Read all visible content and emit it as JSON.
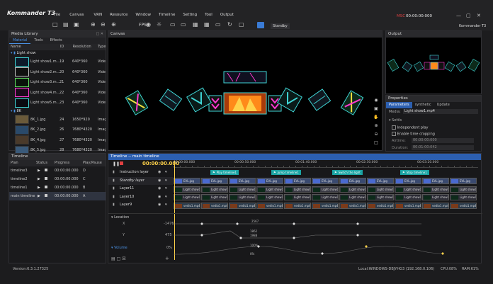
{
  "app": {
    "logo": "Kommander T3",
    "title_right": "Kommander T3",
    "timecode": "00:00:00:000",
    "timecode_prefix": "MSC"
  },
  "menu": [
    "File",
    "Canvas",
    "VRN",
    "Resource",
    "Window",
    "Timeline",
    "Setting",
    "Tool",
    "Output"
  ],
  "toolbar": {
    "fps_label": "FPS",
    "standby_label": "Standby"
  },
  "media_library": {
    "title": "Media Library",
    "tabs": [
      "Material",
      "Tools",
      "Effects"
    ],
    "columns": [
      "Name",
      "ID",
      "Resolution",
      "Type"
    ],
    "groups": [
      {
        "name": "Light show",
        "rows": [
          {
            "name": "Light show1.m...",
            "id": "19",
            "res": "640*360",
            "type": "Vide"
          },
          {
            "name": "Light show2.m...",
            "id": "20",
            "res": "640*360",
            "type": "Vide"
          },
          {
            "name": "Light show3.m...",
            "id": "21",
            "res": "640*360",
            "type": "Vide"
          },
          {
            "name": "Light show4.m...",
            "id": "22",
            "res": "640*360",
            "type": "Vide"
          },
          {
            "name": "Light show5.m...",
            "id": "23",
            "res": "640*360",
            "type": "Vide"
          }
        ]
      },
      {
        "name": "8K",
        "rows": [
          {
            "name": "8K_1.jpg",
            "id": "24",
            "res": "1650*920",
            "type": "Imag"
          },
          {
            "name": "8K_2.jpg",
            "id": "26",
            "res": "7680*4320",
            "type": "Imag"
          },
          {
            "name": "8K_4.jpg",
            "id": "27",
            "res": "7680*4320",
            "type": "Imag"
          },
          {
            "name": "8K_5.jpg",
            "id": "28",
            "res": "7680*4320",
            "type": "Imag"
          },
          {
            "name": "8K_3.jpg",
            "id": "29",
            "res": "7680*4320",
            "type": "Imag"
          }
        ]
      }
    ]
  },
  "canvas": {
    "title": "Canvas"
  },
  "output": {
    "title": "Output"
  },
  "properties": {
    "title": "Properties",
    "tabs": [
      "Parameters",
      "synthetic",
      "Update"
    ],
    "media_label": "Media:",
    "media_value": "Light show1.mp4",
    "section": "Settls",
    "independent_play": "Independent play",
    "enable_cropping": "Enable time cropping",
    "airtime_label": "Airtime:",
    "airtime_value": "00:00:00:000",
    "duration_label": "Duration:",
    "duration_value": "00:01:00:042"
  },
  "timeline_list": {
    "title": "Timeline",
    "columns": [
      "Plan",
      "Status",
      "Progress",
      "Play/Pause"
    ],
    "rows": [
      {
        "plan": "timeline3",
        "progress": "00:00:00.000",
        "key": "D"
      },
      {
        "plan": "timeline2",
        "progress": "00:00:00.000",
        "key": "C"
      },
      {
        "plan": "timeline1",
        "progress": "00:00:00.000",
        "key": "B"
      },
      {
        "plan": "main timeline",
        "progress": "00:00:00.000",
        "key": "A"
      }
    ]
  },
  "main_timeline": {
    "title": "Timeline -- main timeline",
    "timecode": "00:00:00.000",
    "ruler": [
      "00:00:00.000",
      "00:00:50.000",
      "00:01:40.000",
      "00:02:30.000",
      "00:03:20.000"
    ],
    "layers": [
      "Instruction layer",
      "Standby layer",
      "Layer11",
      "Layer10",
      "Layer9"
    ],
    "instructions": [
      "Play timeline1",
      "Jump timeline1",
      "Switch the light",
      "Stop timeline1"
    ],
    "clip_a": "EVL.jpg",
    "clip_b": "Light show1.mp4",
    "clip_c": "vedio1.mp4",
    "location_label": "Location",
    "x_label": "X",
    "x_value": "-1476",
    "y_label": "Y",
    "y_value": "475",
    "volume_label": "Volume",
    "volume_value": "0%",
    "kf_x": "2567",
    "kf_y1": "1862",
    "kf_y2": "1988",
    "kf_vol1": "100%",
    "kf_vol2": "0%"
  },
  "status": {
    "version": "Version:6.3.1.27325",
    "host": "Local:WINDOWS-DBJYHG3 (192.168.0.106)",
    "cpu": "CPU:08%",
    "ram": "RAM:61%"
  }
}
